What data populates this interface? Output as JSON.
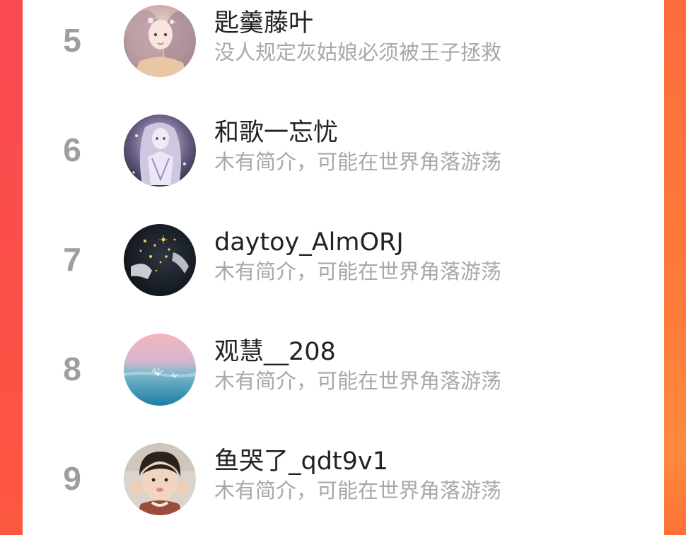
{
  "colors": {
    "rank": "#9e9e9e",
    "name": "#222222",
    "bio": "#a8a8a8",
    "left_border": "#fa4a52",
    "right_border": "#fe7a3a"
  },
  "ranking": {
    "items": [
      {
        "rank": "5",
        "name": "匙羹藤叶",
        "bio": "没人规定灰姑娘必须被王子拯救",
        "avatar": "avatar-anime-girl-pink"
      },
      {
        "rank": "6",
        "name": "和歌一忘忧",
        "bio": "木有简介，可能在世界角落游荡",
        "avatar": "avatar-anime-girl-lavender"
      },
      {
        "rank": "7",
        "name": "daytoy_AlmORJ",
        "bio": "木有简介，可能在世界角落游荡",
        "avatar": "avatar-dark-sparkles"
      },
      {
        "rank": "8",
        "name": "观慧__208",
        "bio": "木有简介，可能在世界角落游荡",
        "avatar": "avatar-pink-sea"
      },
      {
        "rank": "9",
        "name": "鱼哭了_qdt9v1",
        "bio": "木有简介，可能在世界角落游荡",
        "avatar": "avatar-child-photo"
      }
    ]
  }
}
